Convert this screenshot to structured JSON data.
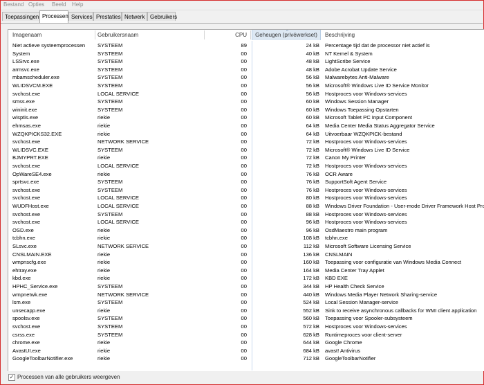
{
  "menu": [
    "Bestand",
    "Opties",
    "Beeld",
    "Help"
  ],
  "tabs": [
    {
      "label": "Toepassingen",
      "active": false
    },
    {
      "label": "Processen",
      "active": true
    },
    {
      "label": "Services",
      "active": false
    },
    {
      "label": "Prestaties",
      "active": false
    },
    {
      "label": "Netwerk",
      "active": false
    },
    {
      "label": "Gebruikers",
      "active": false
    }
  ],
  "columns": {
    "name": "Imagenaam",
    "user": "Gebruikersnaam",
    "cpu": "CPU",
    "memory": "Geheugen (privéwerkset)",
    "description": "Beschrijving"
  },
  "rows": [
    [
      "Niet actieve systeemprocessen",
      "SYSTEEM",
      "89",
      "24 kB",
      "Percentage tijd dat de processor niet actief is"
    ],
    [
      "System",
      "SYSTEEM",
      "00",
      "40 kB",
      "NT Kernel & System"
    ],
    [
      "LSSrvc.exe",
      "SYSTEEM",
      "00",
      "48 kB",
      "LightScribe Service"
    ],
    [
      "armsvc.exe",
      "SYSTEEM",
      "00",
      "48 kB",
      "Adobe Acrobat Update Service"
    ],
    [
      "mbamscheduler.exe",
      "SYSTEEM",
      "00",
      "56 kB",
      "Malwarebytes Anti-Malware"
    ],
    [
      "WLIDSVCM.EXE",
      "SYSTEEM",
      "00",
      "56 kB",
      "Microsoft® Windows Live ID Service Monitor"
    ],
    [
      "svchost.exe",
      "LOCAL SERVICE",
      "00",
      "56 kB",
      "Hostproces voor Windows-services"
    ],
    [
      "smss.exe",
      "SYSTEEM",
      "00",
      "60 kB",
      "Windows Session Manager"
    ],
    [
      "wininit.exe",
      "SYSTEEM",
      "00",
      "60 kB",
      "Windows Toepassing Opstarten"
    ],
    [
      "wisptis.exe",
      "riekie",
      "00",
      "60 kB",
      "Microsoft Tablet PC Input Component"
    ],
    [
      "ehmsas.exe",
      "riekie",
      "00",
      "64 kB",
      "Media Center Media Status Aggregator Service"
    ],
    [
      "WZQKPICKS32.EXE",
      "riekie",
      "00",
      "64 kB",
      "Uitvoerbaar WZQKPICK-bestand"
    ],
    [
      "svchost.exe",
      "NETWORK SERVICE",
      "00",
      "72 kB",
      "Hostproces voor Windows-services"
    ],
    [
      "WLIDSVC.EXE",
      "SYSTEEM",
      "00",
      "72 kB",
      "Microsoft® Windows Live ID Service"
    ],
    [
      "BJMYPRT.EXE",
      "riekie",
      "00",
      "72 kB",
      "Canon My Printer"
    ],
    [
      "svchost.exe",
      "LOCAL SERVICE",
      "00",
      "72 kB",
      "Hostproces voor Windows-services"
    ],
    [
      "OpWareSE4.exe",
      "riekie",
      "00",
      "76 kB",
      "OCR Aware"
    ],
    [
      "sprtsvc.exe",
      "SYSTEEM",
      "00",
      "76 kB",
      "SupportSoft Agent Service"
    ],
    [
      "svchost.exe",
      "SYSTEEM",
      "00",
      "76 kB",
      "Hostproces voor Windows-services"
    ],
    [
      "svchost.exe",
      "LOCAL SERVICE",
      "00",
      "80 kB",
      "Hostproces voor Windows-services"
    ],
    [
      "WUDFHost.exe",
      "LOCAL SERVICE",
      "00",
      "88 kB",
      "Windows Driver Foundation - User-mode Driver Framework Host Proc"
    ],
    [
      "svchost.exe",
      "SYSTEEM",
      "00",
      "88 kB",
      "Hostproces voor Windows-services"
    ],
    [
      "svchost.exe",
      "LOCAL SERVICE",
      "00",
      "96 kB",
      "Hostproces voor Windows-services"
    ],
    [
      "OSD.exe",
      "riekie",
      "00",
      "96 kB",
      "OsdMaestro main program"
    ],
    [
      "tcbhn.exe",
      "riekie",
      "00",
      "108 kB",
      "tcbhn.exe"
    ],
    [
      "SLsvc.exe",
      "NETWORK SERVICE",
      "00",
      "112 kB",
      "Microsoft Software Licensing Service"
    ],
    [
      "CNSLMAIN.EXE",
      "riekie",
      "00",
      "136 kB",
      "CNSLMAIN"
    ],
    [
      "wmpnscfg.exe",
      "riekie",
      "00",
      "160 kB",
      "Toepassing voor configuratie van Windows Media Connect"
    ],
    [
      "ehtray.exe",
      "riekie",
      "00",
      "164 kB",
      "Media Center Tray Applet"
    ],
    [
      "kbd.exe",
      "riekie",
      "00",
      "172 kB",
      "KBD EXE"
    ],
    [
      "HPHC_Service.exe",
      "SYSTEEM",
      "00",
      "344 kB",
      "HP Health Check Service"
    ],
    [
      "wmpnetwk.exe",
      "NETWORK SERVICE",
      "00",
      "440 kB",
      "Windows Media Player Network Sharing-service"
    ],
    [
      "lsm.exe",
      "SYSTEEM",
      "00",
      "524 kB",
      "Local Session Manager-service"
    ],
    [
      "unsecapp.exe",
      "riekie",
      "00",
      "552 kB",
      "Sink to receive asynchronous callbacks for WMI client application"
    ],
    [
      "spoolsv.exe",
      "SYSTEEM",
      "00",
      "560 kB",
      "Toepassing voor Spooler-subsysteem"
    ],
    [
      "svchost.exe",
      "SYSTEEM",
      "00",
      "572 kB",
      "Hostproces voor Windows-services"
    ],
    [
      "csrss.exe",
      "SYSTEEM",
      "00",
      "628 kB",
      "Runtimeproces voor client-server"
    ],
    [
      "chrome.exe",
      "riekie",
      "00",
      "644 kB",
      "Google Chrome"
    ],
    [
      "AvastUI.exe",
      "riekie",
      "00",
      "684 kB",
      "avast! Antivirus"
    ],
    [
      "GoogleToolbarNotifier.exe",
      "riekie",
      "00",
      "712 kB",
      "GoogleToolbarNotifier"
    ]
  ],
  "footer": {
    "checkbox_label": "Processen van alle gebruikers weergeven",
    "checked": true
  }
}
